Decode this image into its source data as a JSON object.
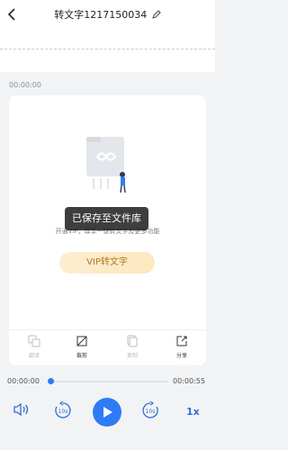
{
  "header": {
    "title": "转文字1217150034"
  },
  "player": {
    "timestamp": "00:00:00",
    "current_time": "00:00:00",
    "total_time": "00:00:55",
    "progress": 0.0,
    "speed": "1x"
  },
  "promo": {
    "text": "开通VIP，尊享一键转文字及更多功能",
    "vip_button": "VIP转文字"
  },
  "toast": {
    "text": "已保存至文件库"
  },
  "tools": [
    {
      "label": "翻译",
      "icon": "translate-icon",
      "enabled": false
    },
    {
      "label": "裁剪",
      "icon": "crop-icon",
      "enabled": true
    },
    {
      "label": "复制",
      "icon": "copy-icon",
      "enabled": false
    },
    {
      "label": "分享",
      "icon": "share-icon",
      "enabled": true
    }
  ],
  "controls": {
    "rewind_label": "10s",
    "forward_label": "10s"
  },
  "colors": {
    "accent": "#2d7cf6",
    "vip_text": "#b3771f",
    "vip_bg": "#fdeed1",
    "page_bg": "#f2f3f5"
  }
}
